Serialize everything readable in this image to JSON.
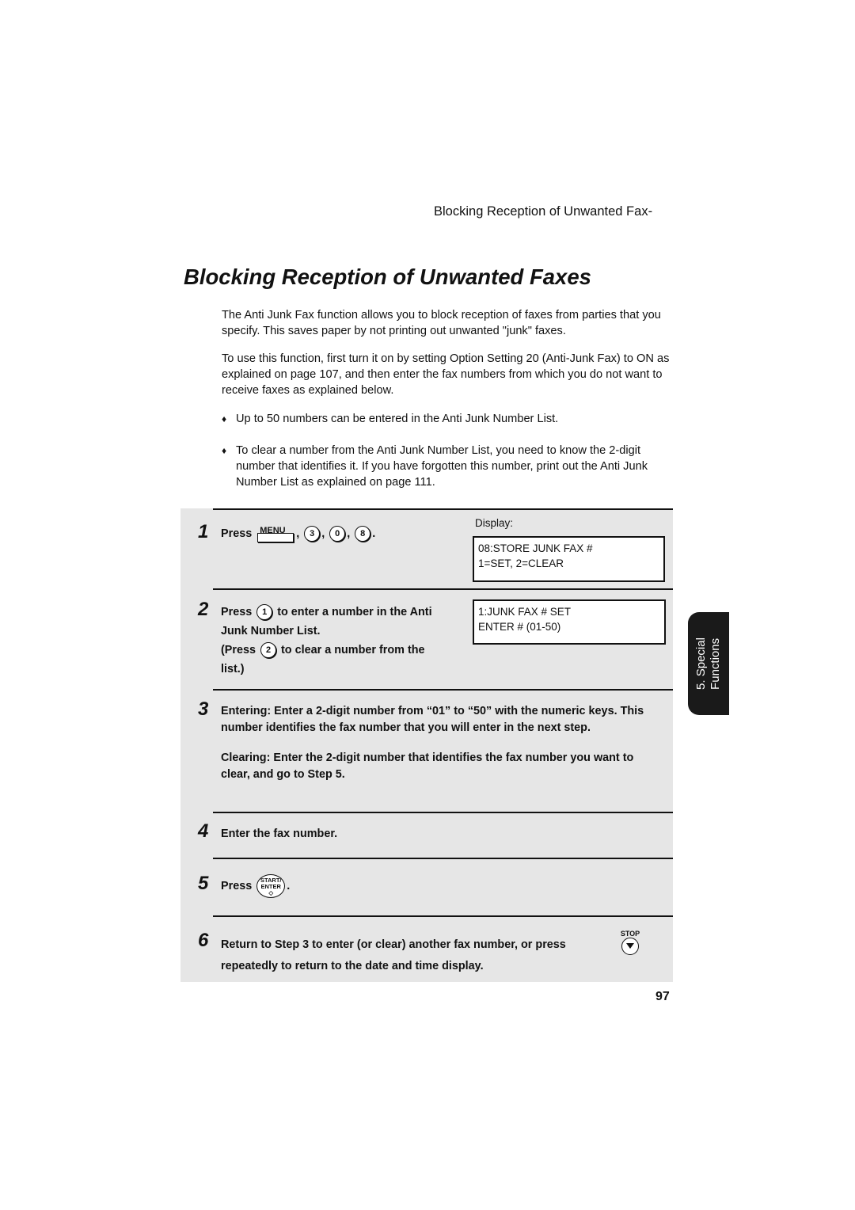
{
  "running_head": "Blocking Reception of Unwanted Fax-",
  "title": "Blocking Reception of Unwanted Faxes",
  "intro": [
    "The Anti Junk Fax function allows you to block reception of faxes from parties that you specify. This saves paper by not printing out unwanted \"junk\" faxes.",
    "To use this function, first turn it on by setting Option Setting 20 (Anti-Junk Fax) to ON as explained on page 107, and then enter the fax numbers from which you do not want to receive faxes as explained below."
  ],
  "bullets": [
    "Up to 50 numbers can be entered in the Anti Junk Number List.",
    "To clear a number from the Anti Junk Number List, you need to know the 2-digit number that identifies it. If you have forgotten this number, print out the Anti Junk Number List as explained on page 111."
  ],
  "bullet_glyph": "♦",
  "steps": {
    "s1": {
      "num": "1",
      "press": "Press",
      "menu_key": "MENU",
      "keys": [
        "3",
        "0",
        "8"
      ],
      "sep": ",",
      "end": "."
    },
    "s2": {
      "num": "2",
      "press": "Press",
      "key1": "1",
      "text1": "to enter a number in the Anti",
      "text2": "Junk Number List.",
      "press2": "(Press",
      "key2": "2",
      "text3": "to clear a number from the",
      "text4": "list.)"
    },
    "s3": {
      "num": "3",
      "entering": "Entering: Enter a 2-digit number from “01” to “50” with the numeric keys. This number identifies the fax number that you will enter in the next step.",
      "clearing": "Clearing: Enter the 2-digit number that identifies the fax number you want to clear, and go to Step 5."
    },
    "s4": {
      "num": "4",
      "text": "Enter the fax number."
    },
    "s5": {
      "num": "5",
      "press": "Press",
      "key_line1": "START/",
      "key_line2": "ENTER",
      "key_symbol": "◇",
      "end": "."
    },
    "s6": {
      "num": "6",
      "line1": "Return to Step 3 to enter (or clear) another fax number, or press",
      "line2": "repeatedly to return to the date and time display.",
      "stop_label": "STOP"
    }
  },
  "display": {
    "label": "Display:",
    "screen1": [
      "08:STORE JUNK FAX #",
      "1=SET, 2=CLEAR"
    ],
    "screen2": [
      "1:JUNK FAX # SET",
      "ENTER # (01-50)"
    ]
  },
  "side_tab": {
    "line1": "5. Special",
    "line2": "Functions"
  },
  "page_number": "97"
}
